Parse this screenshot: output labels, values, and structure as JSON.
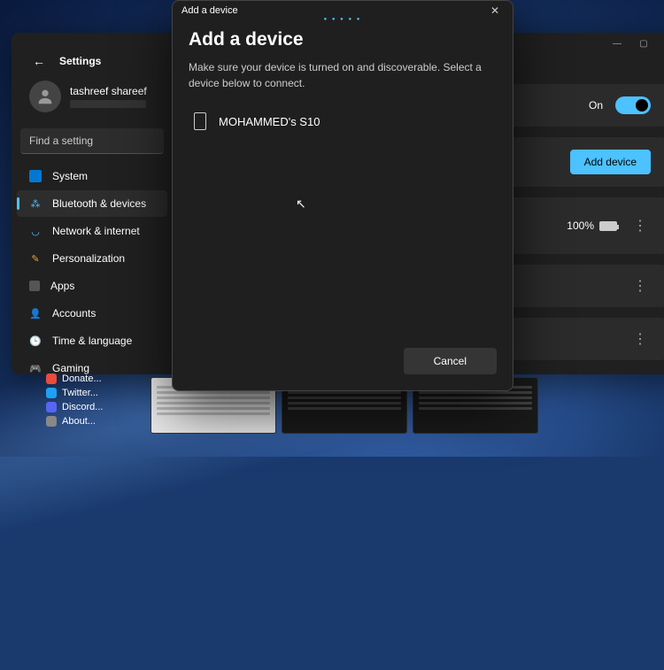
{
  "settings": {
    "title": "Settings",
    "user": {
      "name": "tashreef shareef"
    },
    "search_placeholder": "Find a setting",
    "nav": {
      "system": "System",
      "bluetooth": "Bluetooth & devices",
      "network": "Network & internet",
      "personalization": "Personalization",
      "apps": "Apps",
      "accounts": "Accounts",
      "time": "Time & language",
      "gaming": "Gaming"
    },
    "content": {
      "on_label": "On",
      "add_device": "Add device",
      "battery": "100%"
    }
  },
  "pinned": {
    "donate": "Donate...",
    "twitter": "Twitter...",
    "discord": "Discord...",
    "about": "About..."
  },
  "modal": {
    "titlebar": "Add a device",
    "heading": "Add a device",
    "subtitle": "Make sure your device is turned on and discoverable. Select a device below to connect.",
    "device": "MOHAMMED's S10",
    "cancel": "Cancel"
  }
}
